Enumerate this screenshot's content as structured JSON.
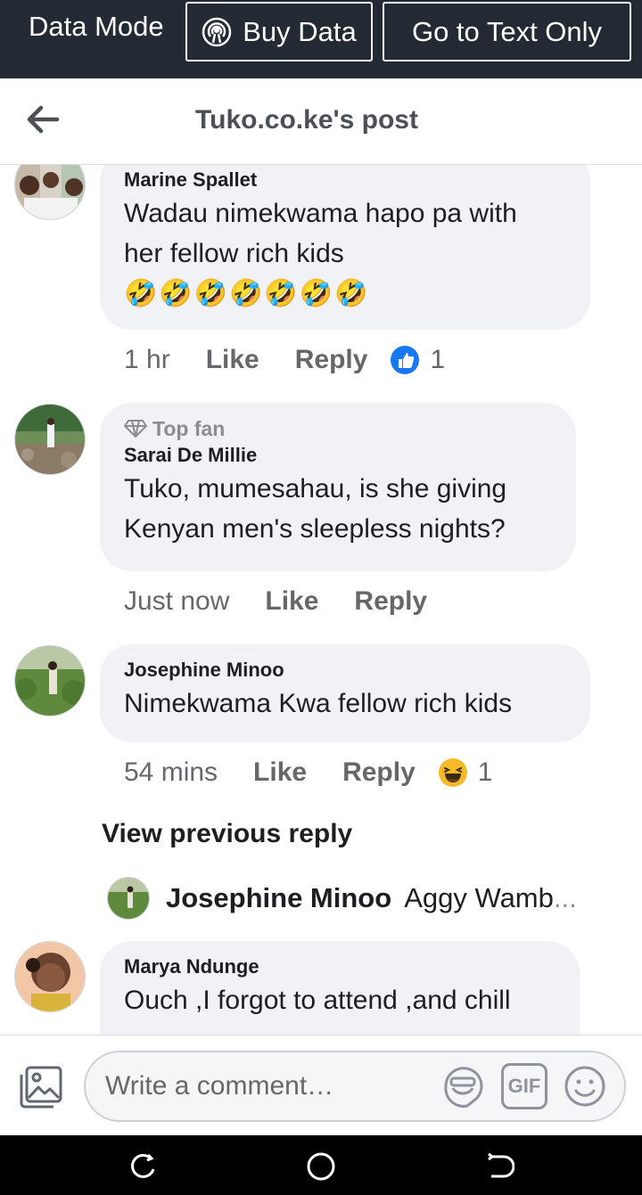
{
  "topbar": {
    "mode_label": "Data Mode",
    "buy_label": "Buy Data",
    "text_only_label": "Go to Text Only"
  },
  "header": {
    "title": "Tuko.co.ke's post"
  },
  "comments": [
    {
      "author": "Marine Spallet",
      "lines": [
        "Wadau nimekwama hapo pa with",
        "her fellow rich kids"
      ],
      "emoji": "🤣🤣🤣🤣🤣🤣🤣",
      "time": "1 hr",
      "like": "Like",
      "reply": "Reply",
      "reaction": "like-icon",
      "reaction_count": "1"
    },
    {
      "badge": "Top fan",
      "author": "Sarai De Millie",
      "lines": [
        "Tuko, mumesahau, is she giving",
        "Kenyan men's sleepless nights?"
      ],
      "time": "Just now",
      "like": "Like",
      "reply": "Reply"
    },
    {
      "author": "Josephine Minoo",
      "lines": [
        "Nimekwama Kwa fellow rich kids"
      ],
      "time": "54 mins",
      "like": "Like",
      "reply": "Reply",
      "reaction": "haha-icon",
      "reaction_count": "1"
    },
    {
      "author": "Marya Ndunge",
      "lines": [
        "Ouch ,I forgot to attend ,and chill"
      ]
    }
  ],
  "view_previous": "View previous reply",
  "reply_preview": {
    "author": "Josephine Minoo",
    "text": "Aggy Wamb",
    "ellipsis": "..."
  },
  "composer": {
    "placeholder": "Write a comment…",
    "gif_label": "GIF"
  },
  "colors": {
    "topbar": "#232a33",
    "bubble": "#f0f2f5",
    "like_blue": "#1877f2",
    "meta_gray": "#65676b"
  }
}
